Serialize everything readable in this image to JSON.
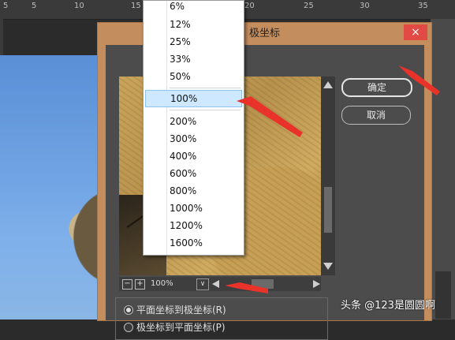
{
  "ruler": {
    "numbers": [
      "5",
      "5",
      "10",
      "15",
      "20",
      "25",
      "30",
      "35"
    ]
  },
  "dialog": {
    "title": "极坐标",
    "close_label": "×",
    "ok_label": "确定",
    "cancel_label": "取消",
    "zoom": {
      "minus": "−",
      "plus": "+",
      "value": "100%",
      "arrow": "∨"
    },
    "radio_options": [
      {
        "label": "平面坐标到极坐标(R)",
        "selected": true
      },
      {
        "label": "极坐标到平面坐标(P)",
        "selected": false
      }
    ]
  },
  "zoom_menu": {
    "options": [
      "6%",
      "12%",
      "25%",
      "33%",
      "50%",
      "100%",
      "200%",
      "300%",
      "400%",
      "600%",
      "800%",
      "1000%",
      "1200%",
      "1600%"
    ],
    "selected": "100%"
  },
  "watermark": "头条 @123是圆圆啊",
  "colors": {
    "dialog_frame": "#c48d5e",
    "dialog_body": "#4c4c4c",
    "close_button": "#e24b45",
    "selection": "#cde8ff",
    "annotation_arrow": "#e8322a"
  },
  "icons": {
    "close": "close-icon",
    "scroll_up": "arrow-up-icon",
    "scroll_down": "arrow-down-icon",
    "scroll_left": "arrow-left-icon",
    "scroll_right": "arrow-right-icon",
    "zoom_dropdown": "chevron-down-icon"
  }
}
